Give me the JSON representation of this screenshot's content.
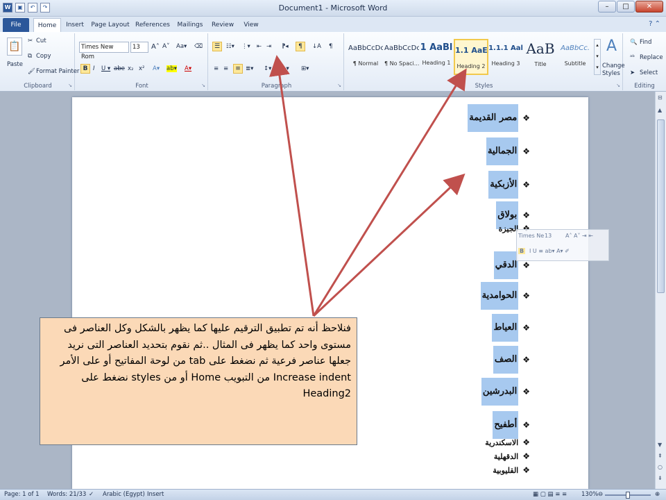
{
  "window": {
    "title": "Document1 - Microsoft Word",
    "word_icon": "W",
    "min": "–",
    "max": "□",
    "close": "✕"
  },
  "tabs": [
    "File",
    "Home",
    "Insert",
    "Page Layout",
    "References",
    "Mailings",
    "Review",
    "View"
  ],
  "ribbon": {
    "clipboard": {
      "label": "Clipboard",
      "paste": "Paste",
      "cut": "Cut",
      "copy": "Copy",
      "format_painter": "Format Painter"
    },
    "font": {
      "label": "Font",
      "name": "Times New Rom",
      "size": "13"
    },
    "paragraph": {
      "label": "Paragraph"
    },
    "styles": {
      "label": "Styles",
      "items": [
        {
          "sample": "AaBbCcDc",
          "name": "¶ Normal"
        },
        {
          "sample": "AaBbCcDc",
          "name": "¶ No Spaci..."
        },
        {
          "sample": "1 AaBl",
          "name": "Heading 1"
        },
        {
          "sample": "1.1 AaE",
          "name": "Heading 2"
        },
        {
          "sample": "1.1.1 Aal",
          "name": "Heading 3"
        },
        {
          "sample": "AaB",
          "name": "Title"
        },
        {
          "sample": "AaBbCc.",
          "name": "Subtitle"
        }
      ],
      "change_styles": "Change Styles"
    },
    "editing": {
      "label": "Editing",
      "find": "Find",
      "replace": "Replace",
      "select": "Select"
    }
  },
  "document": {
    "items": [
      {
        "text": "مصر القديمة",
        "level": 1
      },
      {
        "text": "الجمالية",
        "level": 1
      },
      {
        "text": "الأزبكية",
        "level": 1
      },
      {
        "text": "بولاق",
        "level": 1
      },
      {
        "text": "الجيزة",
        "level": 2
      },
      {
        "text": "الدقي",
        "level": 1
      },
      {
        "text": "الحوامدية",
        "level": 1
      },
      {
        "text": "العياط",
        "level": 1
      },
      {
        "text": "الصف",
        "level": 1
      },
      {
        "text": "البدرشين",
        "level": 1
      },
      {
        "text": "أطفيح",
        "level": 1
      },
      {
        "text": "الاسكندرية",
        "level": 2
      },
      {
        "text": "الدقهلية",
        "level": 2
      },
      {
        "text": "القليوبية",
        "level": 2
      }
    ],
    "bullet": "❖"
  },
  "mini_toolbar": {
    "font": "Times Ne",
    "size": "13"
  },
  "callout": {
    "text": "فنلاحظ أنه تم تطبيق الترقيم عليها كما يظهر بالشكل وكل العناصر فى مستوى واحد كما يظهر فى المثال ..ثم نقوم بتحديد العناصر التى نريد جعلها عناصر فرعية ثم نضغط على tab من لوحة المفاتيح أو على الأمر Increase indent من التبويب Home أو من styles نضغط على Heading2"
  },
  "status": {
    "page": "Page: 1 of 1",
    "words": "Words: 21/33",
    "language": "Arabic (Egypt)",
    "mode": "Insert",
    "zoom": "130%"
  },
  "colors": {
    "accent": "#2b579a",
    "highlight": "#a7c9ef",
    "callout_bg": "#fbd9b7",
    "arrow": "#c0504d"
  }
}
